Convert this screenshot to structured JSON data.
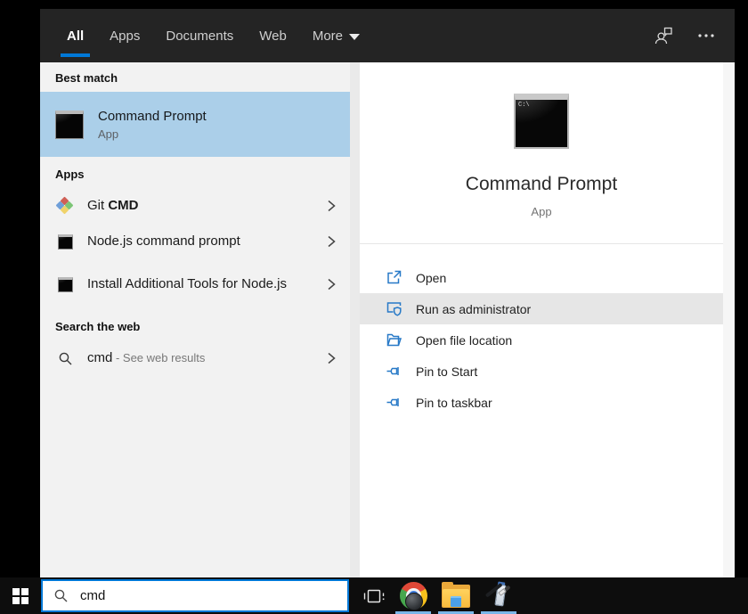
{
  "colors": {
    "accent": "#0078d7",
    "selection_blue": "#abcfe9",
    "row_highlight": "#e6e6e6",
    "action_icon_blue": "#2779c7",
    "header_bg": "#242424",
    "left_pane_bg": "#f2f2f2"
  },
  "header": {
    "tabs": [
      {
        "label": "All",
        "selected": true
      },
      {
        "label": "Apps",
        "selected": false
      },
      {
        "label": "Documents",
        "selected": false
      },
      {
        "label": "Web",
        "selected": false
      },
      {
        "label": "More",
        "selected": false,
        "has_caret": true
      }
    ],
    "icons": [
      "user-feedback-icon",
      "ellipsis-icon"
    ]
  },
  "left_pane": {
    "best_match_label": "Best match",
    "best_match": {
      "title": "Command Prompt",
      "subtitle": "App",
      "icon": "command-prompt-icon",
      "selected": true
    },
    "apps_label": "Apps",
    "apps": [
      {
        "title_regular": "Git ",
        "title_bold": "CMD",
        "icon": "git-icon"
      },
      {
        "title": "Node.js command prompt",
        "icon": "command-prompt-icon"
      },
      {
        "title": "Install Additional Tools for Node.js",
        "icon": "command-prompt-icon"
      }
    ],
    "web_label": "Search the web",
    "web_item": {
      "query": "cmd",
      "suffix": " - See web results",
      "icon": "search-icon"
    }
  },
  "right_pane": {
    "title": "Command Prompt",
    "subtitle": "App",
    "cmd_icon_text": "C:\\",
    "actions": [
      {
        "label": "Open",
        "icon": "open-icon",
        "highlighted": false
      },
      {
        "label": "Run as administrator",
        "icon": "admin-shield-icon",
        "highlighted": true
      },
      {
        "label": "Open file location",
        "icon": "folder-icon",
        "highlighted": false
      },
      {
        "label": "Pin to Start",
        "icon": "pin-icon",
        "highlighted": false
      },
      {
        "label": "Pin to taskbar",
        "icon": "pin-icon",
        "highlighted": false
      }
    ]
  },
  "taskbar": {
    "search_value": "cmd",
    "buttons": [
      "start-button",
      "search-box",
      "task-view-button",
      "chrome-button",
      "file-explorer-button",
      "paint-button"
    ]
  }
}
